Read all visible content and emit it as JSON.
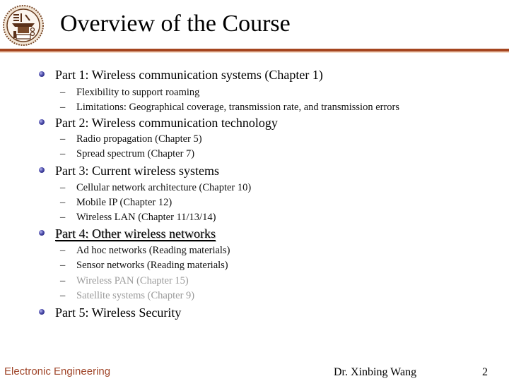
{
  "slide": {
    "title": "Overview of the Course",
    "logo_icon": "university-seal-icon",
    "sections": [
      {
        "label": "Part 1: Wireless communication systems (Chapter 1)",
        "items": [
          "Flexibility to support roaming",
          "Limitations: Geographical coverage, transmission rate, and transmission errors"
        ]
      },
      {
        "label": "Part 2: Wireless communication technology",
        "items": [
          "Radio propagation (Chapter 5)",
          "Spread spectrum (Chapter 7)"
        ]
      },
      {
        "label": "Part 3: Current wireless systems",
        "items": [
          "Cellular network architecture (Chapter 10)",
          "Mobile IP (Chapter 12)",
          "Wireless LAN (Chapter 11/13/14)"
        ]
      },
      {
        "label": "Part 4: Other wireless networks",
        "items": [
          "Ad hoc networks (Reading materials)",
          "Sensor networks (Reading materials)",
          "Wireless PAN (Chapter 15)",
          "Satellite systems (Chapter 9)"
        ]
      },
      {
        "label": "Part 5: Wireless Security",
        "items": []
      }
    ],
    "dash_glyph": "–",
    "colors": {
      "accent_rule": "#a5451f",
      "footer_text": "#a0462a",
      "bullet": "#3a3a98",
      "dimmed_item": "#9a9a9a"
    }
  },
  "footer": {
    "department": "Electronic Engineering",
    "author": "Dr. Xinbing Wang",
    "page_number": "2"
  }
}
